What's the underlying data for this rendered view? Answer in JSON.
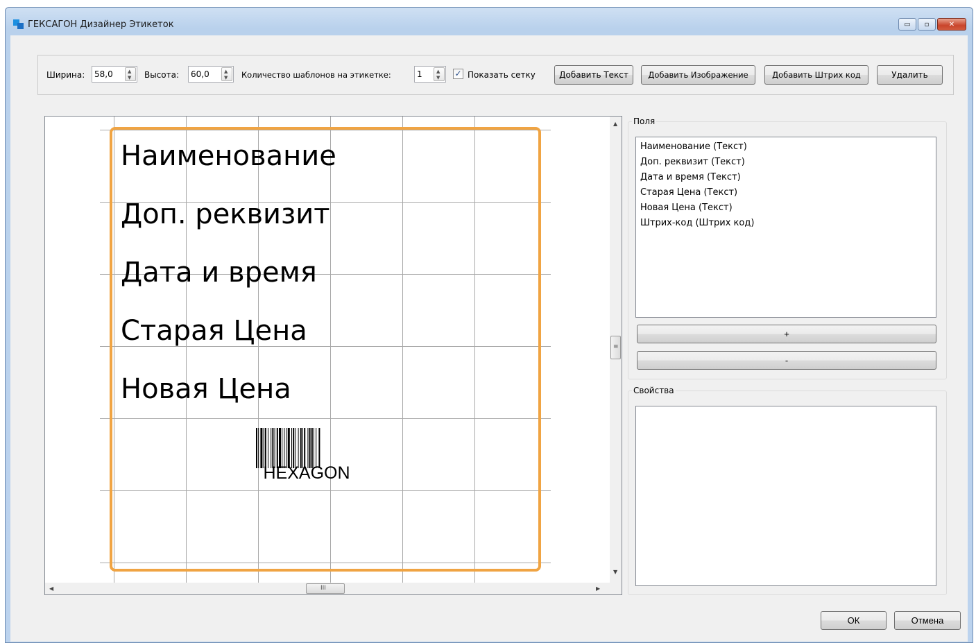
{
  "window": {
    "title": "ГЕКСАГОН Дизайнер Этикеток",
    "controls": {
      "minimize": "▭",
      "maximize": "▫",
      "close": "✕"
    }
  },
  "toolbar": {
    "width_label": "Ширина:",
    "width_value": "58,0",
    "height_label": "Высота:",
    "height_value": "60,0",
    "templates_label": "Количество шаблонов на этикетке:",
    "templates_value": "1",
    "show_grid_label": "Показать сетку",
    "show_grid_checked": true,
    "add_text_label": "Добавить Текст",
    "add_image_label": "Добавить Изображение",
    "add_barcode_label": "Добавить Штрих код",
    "delete_label": "Удалить"
  },
  "canvas": {
    "label_fields": [
      "Наименование",
      "Доп. реквизит",
      "Дата и время",
      "Старая Цена",
      "Новая Цена"
    ],
    "barcode_text": "HEXAGON",
    "label_border_color": "#f0a443",
    "grid_color": "#a8a8a8",
    "scroll_grip": "≡",
    "hscroll_grip": "III"
  },
  "fields_panel": {
    "title": "Поля",
    "items": [
      "Наименование (Текст)",
      "Доп. реквизит (Текст)",
      "Дата и время (Текст)",
      "Старая Цена (Текст)",
      "Новая Цена (Текст)",
      "Штрих-код (Штрих код)"
    ],
    "add_label": "+",
    "remove_label": "-"
  },
  "properties_panel": {
    "title": "Свойства"
  },
  "dialog": {
    "ok_label": "ОК",
    "cancel_label": "Отмена"
  }
}
